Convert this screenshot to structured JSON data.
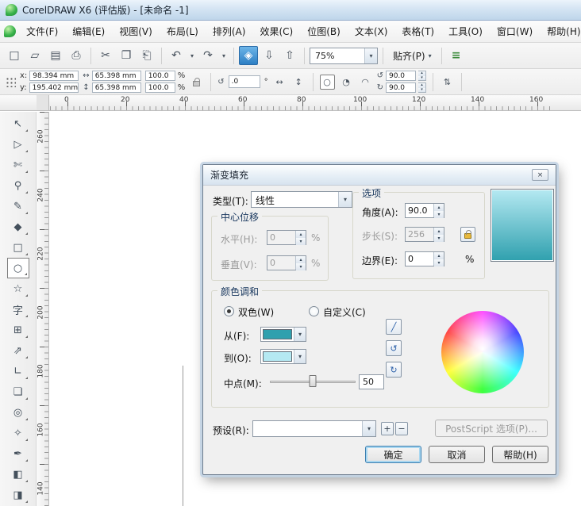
{
  "titlebar": {
    "title": "CorelDRAW X6 (评估版) - [未命名 -1]"
  },
  "menubar": {
    "items": [
      "文件(F)",
      "编辑(E)",
      "视图(V)",
      "布局(L)",
      "排列(A)",
      "效果(C)",
      "位图(B)",
      "文本(X)",
      "表格(T)",
      "工具(O)",
      "窗口(W)",
      "帮助(H)"
    ]
  },
  "toolbar": {
    "new": "□",
    "open": "▱",
    "save": "▤",
    "print": "⎙",
    "cut": "✂",
    "copy": "❐",
    "paste": "⎗",
    "undo": "↶",
    "redo": "↷",
    "welcome": "◈",
    "import": "⇩",
    "export": "⇧",
    "zoom_value": "75%",
    "snap_label": "贴齐(P)",
    "options": "≡"
  },
  "propbar": {
    "x_label": "x:",
    "x_value": "98.394 mm",
    "y_label": "y:",
    "y_value": "195.402 mm",
    "w_icon": "↔",
    "w_value": "65.398 mm",
    "h_icon": "↕",
    "h_value": "65.398 mm",
    "scale_x": "100.0",
    "scale_y": "100.0",
    "pct": "%",
    "rotate_icon": "↺",
    "rotate_value": ".0",
    "deg": "°",
    "mirror_h": "↔",
    "mirror_v": "↕",
    "ellipse_icon": "○",
    "pie_icon": "◔",
    "arc_icon": "◠",
    "start_icon": "↺",
    "end_icon": "↻",
    "start_angle": "90.0",
    "end_angle": "90.0",
    "direction_icon": "⇅"
  },
  "ruler": {
    "h_ticks": [
      "0",
      "20",
      "40",
      "60",
      "80",
      "100",
      "120",
      "140",
      "160"
    ],
    "v_ticks": [
      "260",
      "240",
      "220",
      "200",
      "180",
      "160",
      "140"
    ]
  },
  "toolbox": {
    "tools": [
      {
        "name": "pick-tool",
        "glyph": "↖",
        "selected": false
      },
      {
        "name": "shape-tool",
        "glyph": "▷",
        "selected": false
      },
      {
        "name": "crop-tool",
        "glyph": "✄",
        "selected": false
      },
      {
        "name": "zoom-tool",
        "glyph": "⚲",
        "selected": false
      },
      {
        "name": "freehand-tool",
        "glyph": "✎",
        "selected": false
      },
      {
        "name": "smart-fill-tool",
        "glyph": "◆",
        "selected": false
      },
      {
        "name": "rectangle-tool",
        "glyph": "□",
        "selected": false
      },
      {
        "name": "ellipse-tool",
        "glyph": "○",
        "selected": true
      },
      {
        "name": "polygon-tool",
        "glyph": "☆",
        "selected": false
      },
      {
        "name": "text-tool",
        "glyph": "字",
        "selected": false
      },
      {
        "name": "table-tool",
        "glyph": "⊞",
        "selected": false
      },
      {
        "name": "dimension-tool",
        "glyph": "⇗",
        "selected": false
      },
      {
        "name": "connector-tool",
        "glyph": "∟",
        "selected": false
      },
      {
        "name": "shadow-tool",
        "glyph": "❏",
        "selected": false
      },
      {
        "name": "contour-tool",
        "glyph": "◎",
        "selected": false
      },
      {
        "name": "eyedropper-tool",
        "glyph": "✧",
        "selected": false
      },
      {
        "name": "outline-pen-tool",
        "glyph": "✒",
        "selected": false
      },
      {
        "name": "fill-tool",
        "glyph": "◧",
        "selected": false
      },
      {
        "name": "interactive-fill-tool",
        "glyph": "◨",
        "selected": false
      }
    ]
  },
  "dialog": {
    "title": "渐变填充",
    "type_label": "类型(T):",
    "type_value": "线性",
    "options": {
      "group_label": "选项",
      "angle_label": "角度(A):",
      "angle_value": "90.0",
      "steps_label": "步长(S):",
      "steps_value": "256",
      "edge_label": "边界(E):",
      "edge_value": "0",
      "edge_unit": "%"
    },
    "center": {
      "group_label": "中心位移",
      "h_label": "水平(H):",
      "h_value": "0",
      "h_unit": "%",
      "v_label": "垂直(V):",
      "v_value": "0",
      "v_unit": "%"
    },
    "color_blend": {
      "group_label": "颜色调和",
      "two_color_label": "双色(W)",
      "custom_label": "自定义(C)",
      "from_label": "从(F):",
      "from_color": "#2FA0AE",
      "to_label": "到(O):",
      "to_color": "#B5E9F2",
      "mid_label": "中点(M):",
      "mid_value": "50"
    },
    "presets_label": "预设(R):",
    "presets_value": "",
    "postscript_label": "PostScript 选项(P)...",
    "ok_label": "确定",
    "cancel_label": "取消",
    "help_label": "帮助(H)"
  },
  "ui": {
    "close": "×",
    "dropdown": "▾",
    "spin_up": "▴",
    "spin_dn": "▾",
    "plus": "+",
    "minus": "−",
    "blend_direct": "╱",
    "blend_ccw": "↺",
    "blend_cw": "↻"
  }
}
